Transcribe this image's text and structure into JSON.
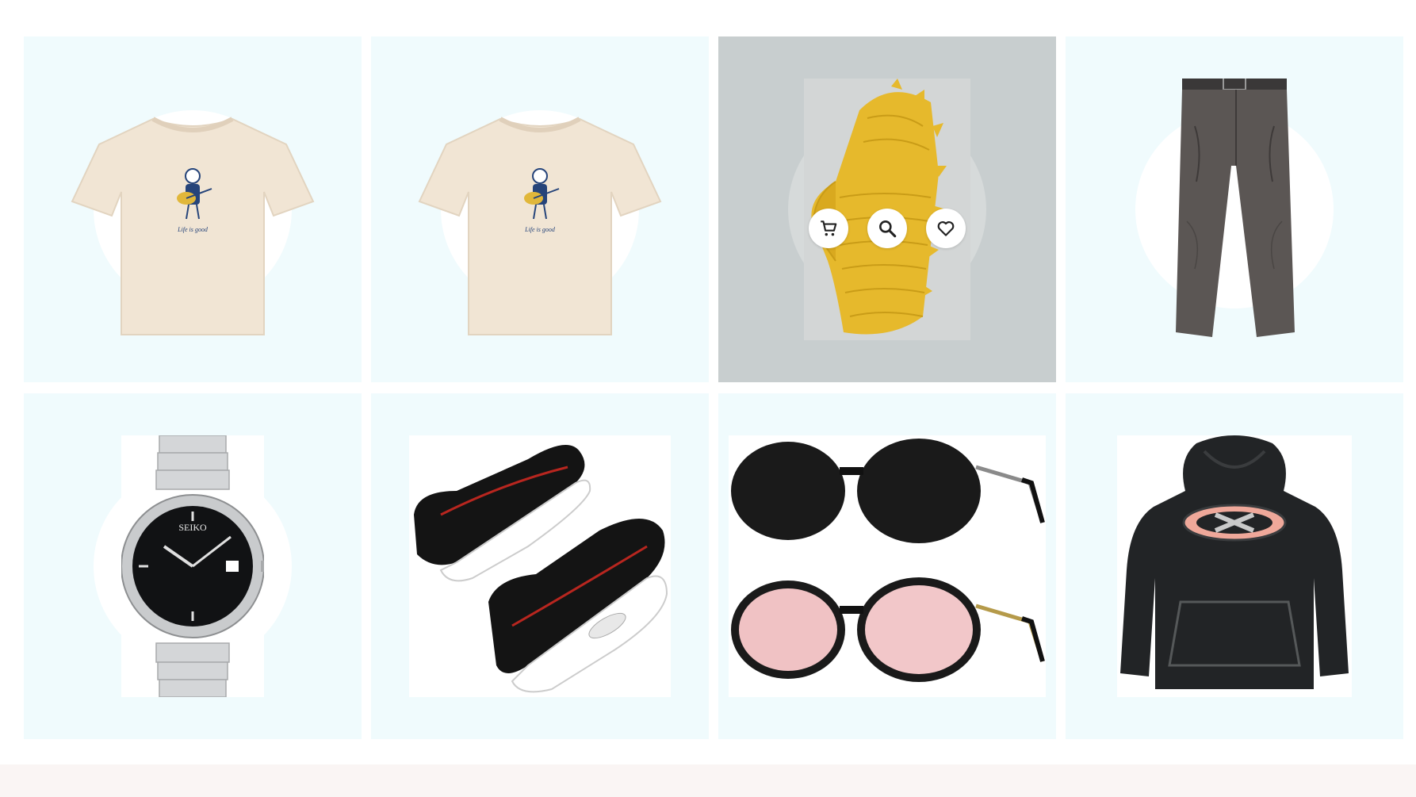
{
  "products": [
    {
      "name": "Cream graphic t-shirt",
      "icon": "tshirt-cream"
    },
    {
      "name": "Cream graphic t-shirt",
      "icon": "tshirt-cream"
    },
    {
      "name": "Yellow dinosaur puffer hoodie",
      "icon": "puffer-jacket-yellow"
    },
    {
      "name": "Dark grey hiking pants",
      "icon": "pants-grey"
    },
    {
      "name": "Silver automatic watch",
      "icon": "watch-silver"
    },
    {
      "name": "Black slip-on air sneakers",
      "icon": "sneakers-black"
    },
    {
      "name": "Round sunglasses two pack",
      "icon": "sunglasses"
    },
    {
      "name": "Black logo hoodie",
      "icon": "hoodie-black"
    }
  ],
  "shirt_text": "Life is good",
  "watch_brand": "SEIKO",
  "hover_actions": [
    {
      "icon": "cart-icon"
    },
    {
      "icon": "search-icon"
    },
    {
      "icon": "heart-icon"
    }
  ],
  "colors": {
    "card_bg": "#f0fbfd",
    "card_hover_bg": "#c8cecf",
    "footer_bg": "#faf5f4"
  }
}
